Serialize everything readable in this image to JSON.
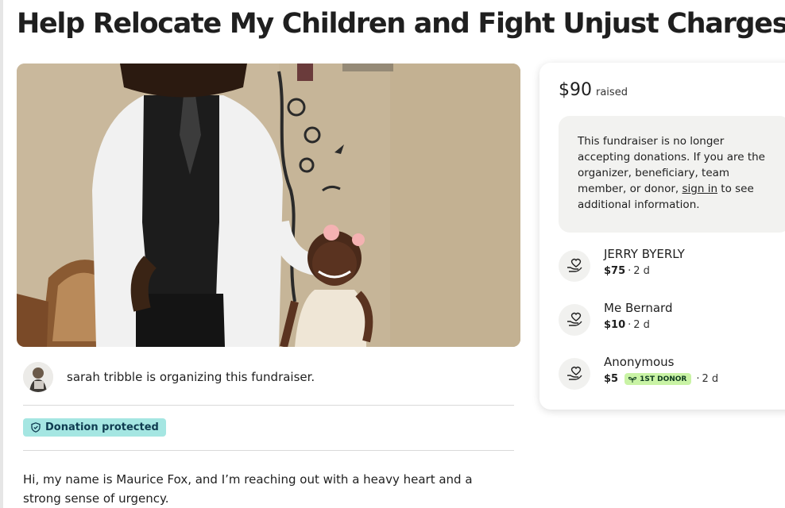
{
  "page": {
    "title": "Help Relocate My Children and Fight Unjust Charges"
  },
  "organizer": {
    "text": "sarah tribble is organizing this fundraiser."
  },
  "protection": {
    "badge_label": "Donation protected",
    "icon": "shield-icon"
  },
  "story": {
    "text": "Hi, my name is Maurice Fox, and I’m reaching out with a heavy heart and a strong sense of urgency."
  },
  "sidebar": {
    "raised_amount": "$90",
    "raised_label": "raised",
    "notice_before_link": "This fundraiser is no longer accepting donations. If you are the organizer, beneficiary, team member, or donor, ",
    "notice_link": "sign in",
    "notice_after_link": " to see additional information.",
    "donors": [
      {
        "name": "JERRY BYERLY",
        "amount": "$75",
        "time": "2 d",
        "badge": ""
      },
      {
        "name": "Me Bernard",
        "amount": "$10",
        "time": "2 d",
        "badge": ""
      },
      {
        "name": "Anonymous",
        "amount": "$5",
        "time": "2 d",
        "badge": "1ST DONOR"
      }
    ],
    "donor_icon": "heart-hand-icon"
  },
  "colors": {
    "protected_badge_bg": "#a5e6e2",
    "first_donor_badge_bg": "#c9f3a5",
    "notice_bg": "#f2f2f0"
  }
}
